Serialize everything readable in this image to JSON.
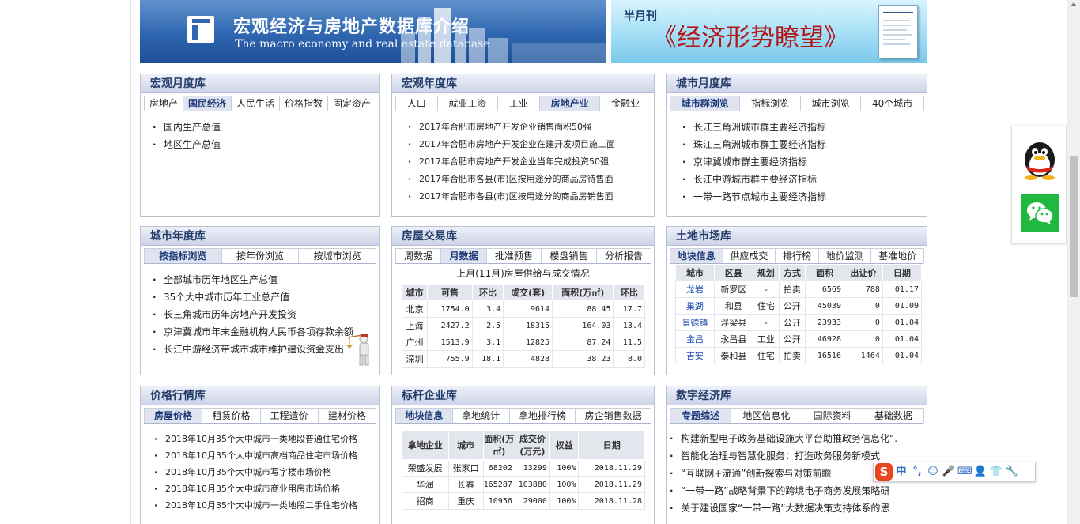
{
  "banners": {
    "left": {
      "title": "宏观经济与房地产数据库介绍",
      "subtitle": "The macro economy and real estate database"
    },
    "right": {
      "label": "半月刊",
      "title": "《经济形势瞭望》"
    }
  },
  "macro_month": {
    "title": "宏观月度库",
    "tabs": [
      "房地产",
      "国民经济",
      "人民生活",
      "价格指数",
      "固定资产"
    ],
    "active": 1,
    "items": [
      "国内生产总值",
      "地区生产总值"
    ]
  },
  "macro_year": {
    "title": "宏观年度库",
    "tabs": [
      "人口",
      "就业工资",
      "工业",
      "房地产业",
      "金融业"
    ],
    "active": 3,
    "items": [
      "2017年合肥市房地产开发企业销售面积50强",
      "2017年合肥市房地产开发企业在建开发项目施工面",
      "2017年合肥市房地产开发企业当年完成投资50强",
      "2017年合肥市各县(市)区按用途分的商品房待售面",
      "2017年合肥市各县(市)区按用途分的商品房销售面"
    ]
  },
  "city_month": {
    "title": "城市月度库",
    "tabs": [
      "城市群浏览",
      "指标浏览",
      "城市浏览",
      "40个城市"
    ],
    "active": 0,
    "items": [
      "长江三角洲城市群主要经济指标",
      "珠江三角洲城市群主要经济指标",
      "京津冀城市群主要经济指标",
      "长江中游城市群主要经济指标",
      "一带一路节点城市主要经济指标"
    ]
  },
  "city_year": {
    "title": "城市年度库",
    "tabs": [
      "按指标浏览",
      "按年份浏览",
      "按城市浏览"
    ],
    "active": 0,
    "items": [
      "全部城市历年地区生产总值",
      "35个大中城市历年工业总产值",
      "长三角城市历年房地产开发投资",
      "京津冀城市年末金融机构人民币各项存款余额",
      "长江中游经济带城市城市维护建设资金支出"
    ]
  },
  "housing": {
    "title": "房屋交易库",
    "tabs": [
      "周数据",
      "月数据",
      "批准预售",
      "楼盘销售",
      "分析报告"
    ],
    "active": 1,
    "caption": "上月(11月)房屋供给与成交情况",
    "headers": [
      "城市",
      "可售",
      "环比",
      "成交(套)",
      "面积(万㎡)",
      "环比"
    ],
    "rows": [
      [
        "北京",
        "1754.0",
        "3.4",
        "9614",
        "88.45",
        "17.7"
      ],
      [
        "上海",
        "2427.2",
        "2.5",
        "18315",
        "164.03",
        "13.4"
      ],
      [
        "广州",
        "1513.9",
        "3.1",
        "12825",
        "87.24",
        "11.5"
      ],
      [
        "深圳",
        "755.9",
        "18.1",
        "4828",
        "38.23",
        "8.0"
      ]
    ]
  },
  "land": {
    "title": "土地市场库",
    "tabs": [
      "地块信息",
      "供应成交",
      "排行榜",
      "地价监测",
      "基准地价"
    ],
    "active": 0,
    "headers": [
      "城市",
      "区县",
      "规划",
      "方式",
      "面积",
      "出让价",
      "日期"
    ],
    "rows": [
      [
        "龙岩",
        "新罗区",
        "-",
        "拍卖",
        "6569",
        "788",
        "01.17"
      ],
      [
        "巢湖",
        "和县",
        "住宅",
        "公开",
        "45039",
        "0",
        "01.09"
      ],
      [
        "景德镇",
        "浮梁县",
        "-",
        "公开",
        "23933",
        "0",
        "01.04"
      ],
      [
        "金昌",
        "永昌县",
        "工业",
        "公开",
        "46928",
        "0",
        "01.04"
      ],
      [
        "吉安",
        "泰和县",
        "住宅",
        "拍卖",
        "16516",
        "1464",
        "01.04"
      ]
    ]
  },
  "price": {
    "title": "价格行情库",
    "tabs": [
      "房屋价格",
      "租赁价格",
      "工程造价",
      "建材价格"
    ],
    "active": 0,
    "items": [
      "2018年10月35个大中城市一类地段普通住宅价格",
      "2018年10月35个大中城市高档商品住宅市场价格",
      "2018年10月35个大中城市写字楼市场价格",
      "2018年10月35个大中城市商业用房市场价格",
      "2018年10月35个大中城市一类地段二手住宅价格"
    ]
  },
  "benchmark": {
    "title": "标杆企业库",
    "tabs": [
      "地块信息",
      "拿地统计",
      "拿地排行榜",
      "房企销售数据"
    ],
    "active": 0,
    "headers": [
      "拿地企业",
      "城市",
      "面积(万㎡)",
      "成交价(万元)",
      "权益",
      "日期"
    ],
    "rows": [
      [
        "荣盛发展",
        "张家口",
        "68202",
        "13299",
        "100%",
        "2018.11.29"
      ],
      [
        "华润",
        "长春",
        "165287",
        "103880",
        "100%",
        "2018.11.29"
      ],
      [
        "招商",
        "重庆",
        "10956",
        "29000",
        "100%",
        "2018.11.28"
      ]
    ]
  },
  "digital": {
    "title": "数字经济库",
    "tabs": [
      "专题综述",
      "地区信息化",
      "国际资料",
      "基础数据"
    ],
    "active": 0,
    "items": [
      "构建新型电子政务基础设施大平台助推政务信息化“.",
      "智能化治理与智慧化服务：打造政务服务新模式",
      "“互联网+流通”创新探索与对策前瞻",
      "“一带一路”战略背景下的跨境电子商务发展策略研",
      "关于建设国家“一带一路”大数据决策支持体系的思"
    ]
  },
  "ime": {
    "logo": "S",
    "lang": "中",
    "punct": "°,"
  }
}
